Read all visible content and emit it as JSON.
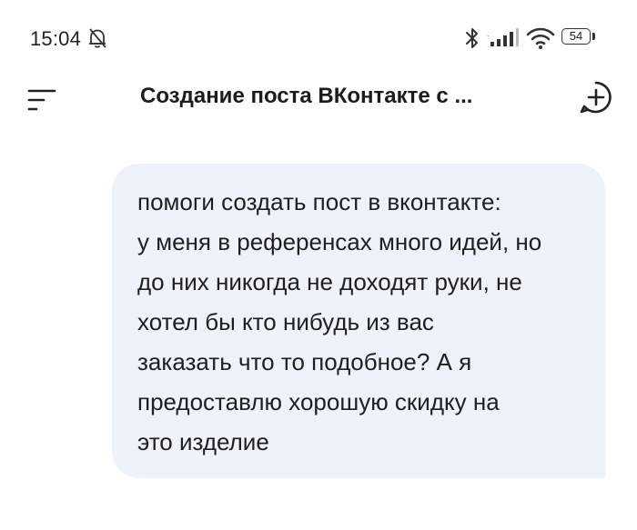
{
  "status_bar": {
    "time": "15:04",
    "battery_level": "54",
    "icons": [
      "bell-off-icon",
      "bluetooth-icon",
      "signal-icon",
      "wifi-icon",
      "battery-icon"
    ]
  },
  "header": {
    "title": "Создание поста ВКонтакте с ...",
    "menu_icon": "menu-icon",
    "new_chat_icon": "new-chat-plus-icon"
  },
  "message": {
    "lines": [
      "помоги создать пост в вконтакте:",
      "у меня в референсах много идей, но",
      "до них никогда не доходят руки, не",
      "хотел бы кто нибудь из вас",
      "заказать что то подобное? А я",
      "предоставлю хорошую скидку на",
      "это изделие"
    ]
  },
  "colors": {
    "bubble_background": "#eef2fb",
    "text": "#1f1f1f",
    "background": "#ffffff"
  }
}
